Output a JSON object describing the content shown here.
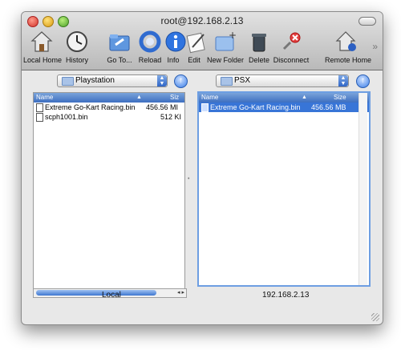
{
  "window": {
    "title": "root@192.168.2.13"
  },
  "toolbar": {
    "items": [
      {
        "label": "Local Home",
        "icon": "house-icon"
      },
      {
        "label": "History",
        "icon": "clock-icon"
      },
      {
        "label": "Go To...",
        "icon": "folder-goto-icon"
      },
      {
        "label": "Reload",
        "icon": "reload-icon"
      },
      {
        "label": "Info",
        "icon": "info-icon"
      },
      {
        "label": "Edit",
        "icon": "edit-icon"
      },
      {
        "label": "New Folder",
        "icon": "new-folder-icon"
      },
      {
        "label": "Delete",
        "icon": "trash-icon"
      },
      {
        "label": "Disconnect",
        "icon": "disconnect-icon"
      },
      {
        "label": "Remote Home",
        "icon": "remote-home-icon"
      }
    ],
    "overflow": "»"
  },
  "local": {
    "path": "Playstation",
    "headers": {
      "name": "Name",
      "size": "Siz"
    },
    "files": [
      {
        "name": "Extreme Go-Kart Racing.bin",
        "size": "456.56 MI"
      },
      {
        "name": "scph1001.bin",
        "size": "512 KI"
      }
    ],
    "status": "Local"
  },
  "remote": {
    "path": "PSX",
    "headers": {
      "name": "Name",
      "size": "Size"
    },
    "files": [
      {
        "name": "Extreme Go-Kart Racing.bin",
        "size": "456.56 MB",
        "selected": true
      }
    ],
    "status": "192.168.2.13"
  },
  "colors": {
    "selection": "#3875d7",
    "header": "#3e6fc0",
    "focus_ring": "#6d9ee2"
  }
}
